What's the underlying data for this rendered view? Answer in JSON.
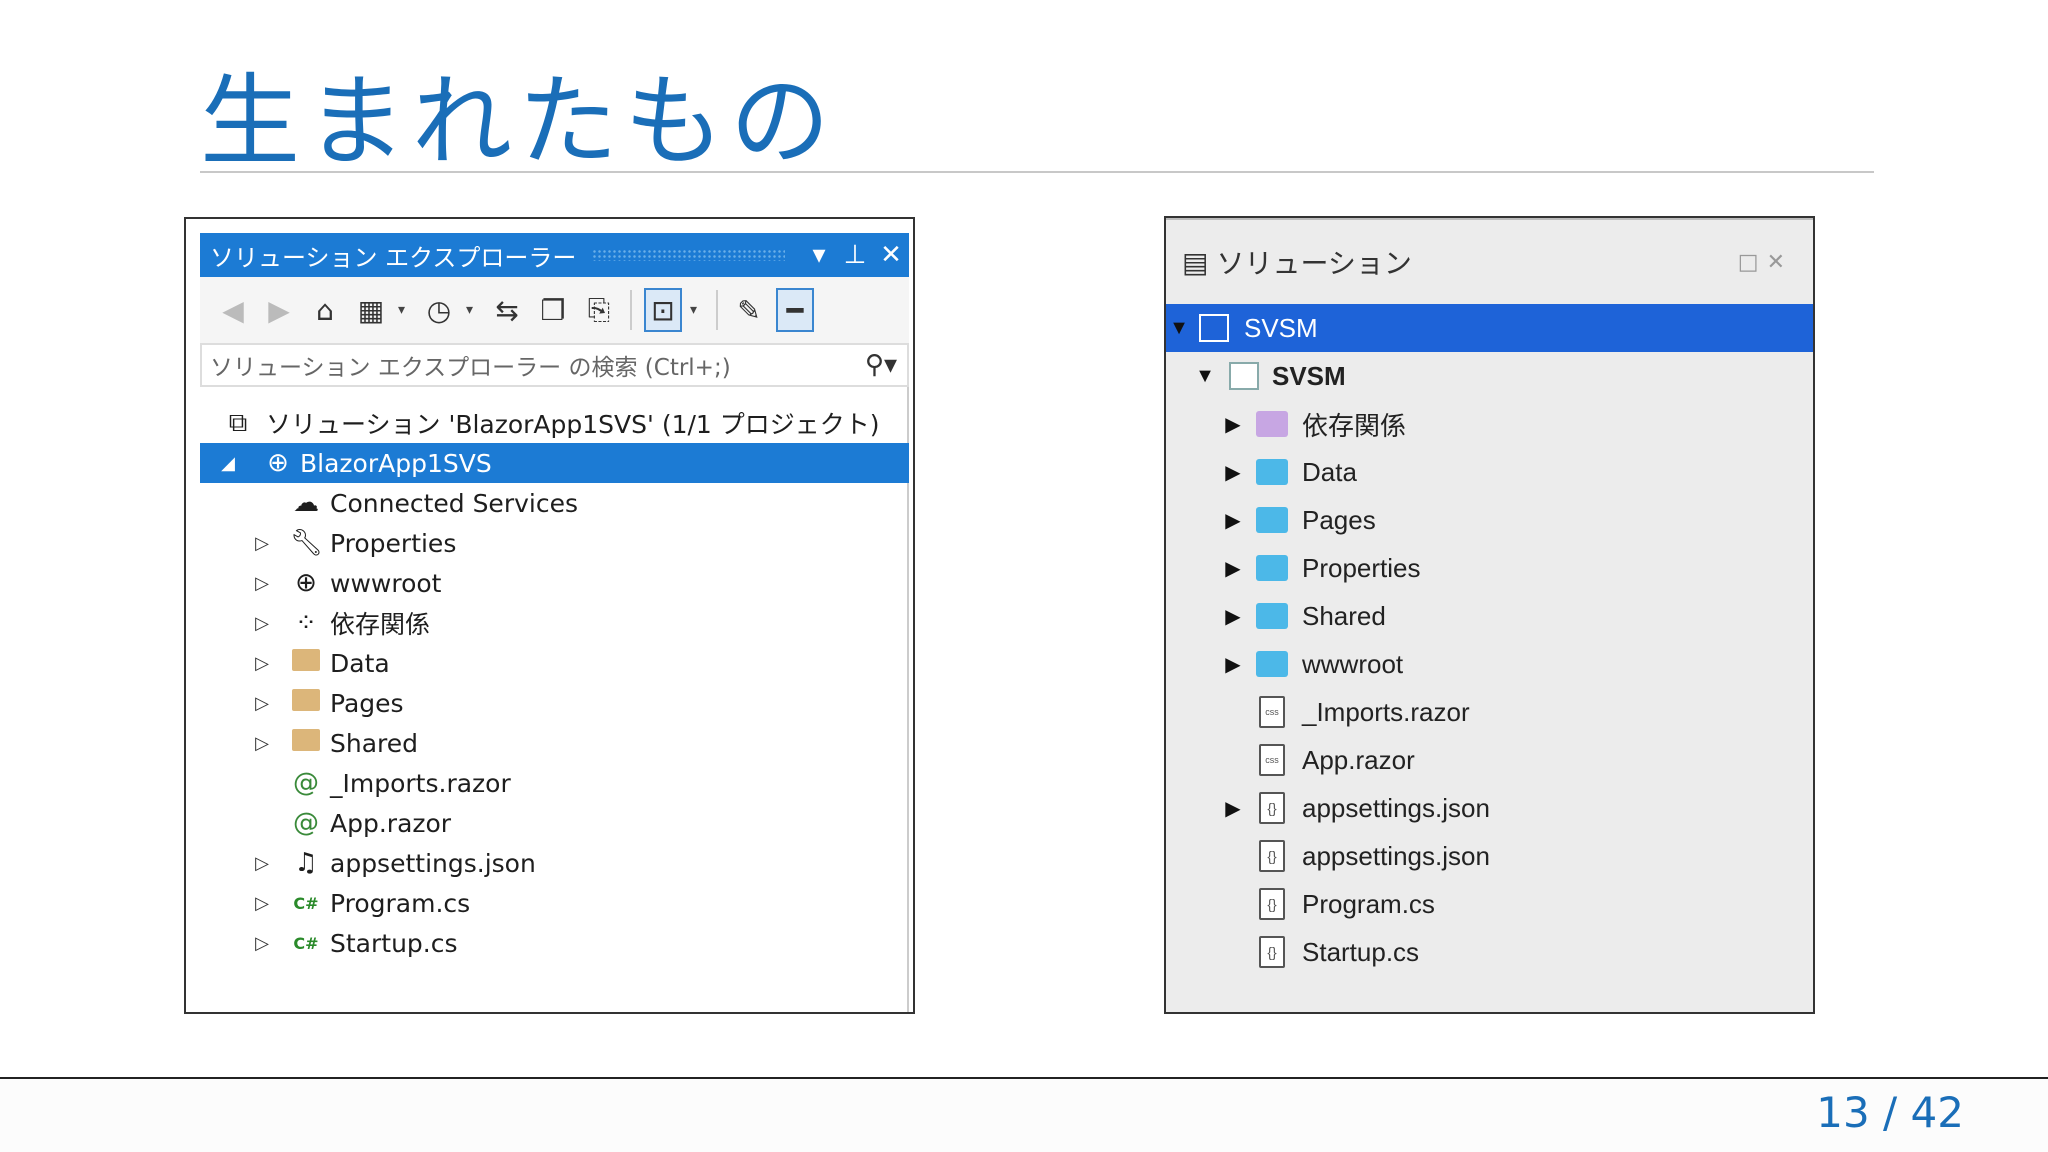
{
  "slide": {
    "title": "生まれたもの",
    "page_number": "13 / 42"
  },
  "colors": {
    "accent": "#1a6eb8",
    "vs_selection": "#1c7bd4",
    "mac_selection": "#1e63d8",
    "mac_folder": "#4cb8e8",
    "vs_folder": "#dcb67a"
  },
  "vs": {
    "title": "ソリューション エクスプローラー",
    "search_placeholder": "ソリューション エクスプローラー の検索 (Ctrl+;)",
    "solution_label": "ソリューション 'BlazorApp1SVS' (1/1 プロジェクト)",
    "project_label": "BlazorApp1SVS",
    "items": [
      {
        "label": "Connected Services",
        "icon": "cloud-icon"
      },
      {
        "label": "Properties",
        "icon": "wrench-icon"
      },
      {
        "label": "wwwroot",
        "icon": "globe-icon"
      },
      {
        "label": "依存関係",
        "icon": "dependencies-icon"
      },
      {
        "label": "Data",
        "icon": "folder-icon"
      },
      {
        "label": "Pages",
        "icon": "folder-icon"
      },
      {
        "label": "Shared",
        "icon": "folder-icon"
      },
      {
        "label": "_Imports.razor",
        "icon": "razor-file-icon"
      },
      {
        "label": "App.razor",
        "icon": "razor-file-icon"
      },
      {
        "label": "appsettings.json",
        "icon": "json-file-icon"
      },
      {
        "label": "Program.cs",
        "icon": "csharp-file-icon"
      },
      {
        "label": "Startup.cs",
        "icon": "csharp-file-icon"
      }
    ]
  },
  "mac": {
    "title": "ソリューション",
    "solution_label": "SVSM",
    "project_label": "SVSM",
    "items": [
      {
        "label": "依存関係",
        "icon": "dependencies-folder-icon"
      },
      {
        "label": "Data",
        "icon": "folder-icon"
      },
      {
        "label": "Pages",
        "icon": "folder-icon"
      },
      {
        "label": "Properties",
        "icon": "folder-icon"
      },
      {
        "label": "Shared",
        "icon": "folder-icon"
      },
      {
        "label": "wwwroot",
        "icon": "folder-icon"
      },
      {
        "label": "_Imports.razor",
        "icon": "css-file-icon"
      },
      {
        "label": "App.razor",
        "icon": "css-file-icon"
      },
      {
        "label": "appsettings.json",
        "icon": "json-file-icon"
      },
      {
        "label": "appsettings.json",
        "icon": "json-file-icon"
      },
      {
        "label": "Program.cs",
        "icon": "json-file-icon"
      },
      {
        "label": "Startup.cs",
        "icon": "json-file-icon"
      }
    ]
  }
}
